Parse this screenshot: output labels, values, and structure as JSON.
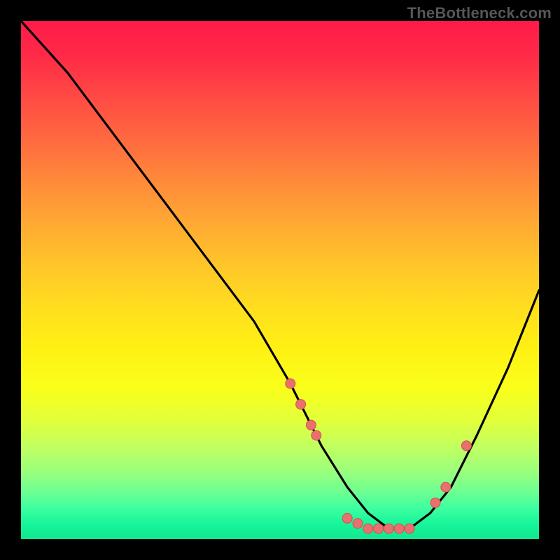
{
  "watermark": "TheBottleneck.com",
  "chart_data": {
    "type": "line",
    "title": "",
    "xlabel": "",
    "ylabel": "",
    "xlim": [
      0,
      100
    ],
    "ylim": [
      0,
      100
    ],
    "series": [
      {
        "name": "bottleneck-curve",
        "x": [
          0,
          9,
          18,
          27,
          36,
          45,
          52,
          58,
          63,
          67,
          71,
          75,
          79,
          83,
          88,
          94,
          100
        ],
        "values": [
          100,
          90,
          78,
          66,
          54,
          42,
          30,
          18,
          10,
          5,
          2,
          2,
          5,
          10,
          20,
          33,
          48
        ]
      }
    ],
    "markers": {
      "name": "highlight-dots",
      "x": [
        52,
        54,
        56,
        57,
        63,
        65,
        67,
        69,
        71,
        73,
        75,
        80,
        82,
        86
      ],
      "values": [
        30,
        26,
        22,
        20,
        4,
        3,
        2,
        2,
        2,
        2,
        2,
        7,
        10,
        18
      ]
    },
    "colors": {
      "curve": "#000000",
      "marker_fill": "#e8716f",
      "marker_stroke": "#d84f4d"
    }
  }
}
